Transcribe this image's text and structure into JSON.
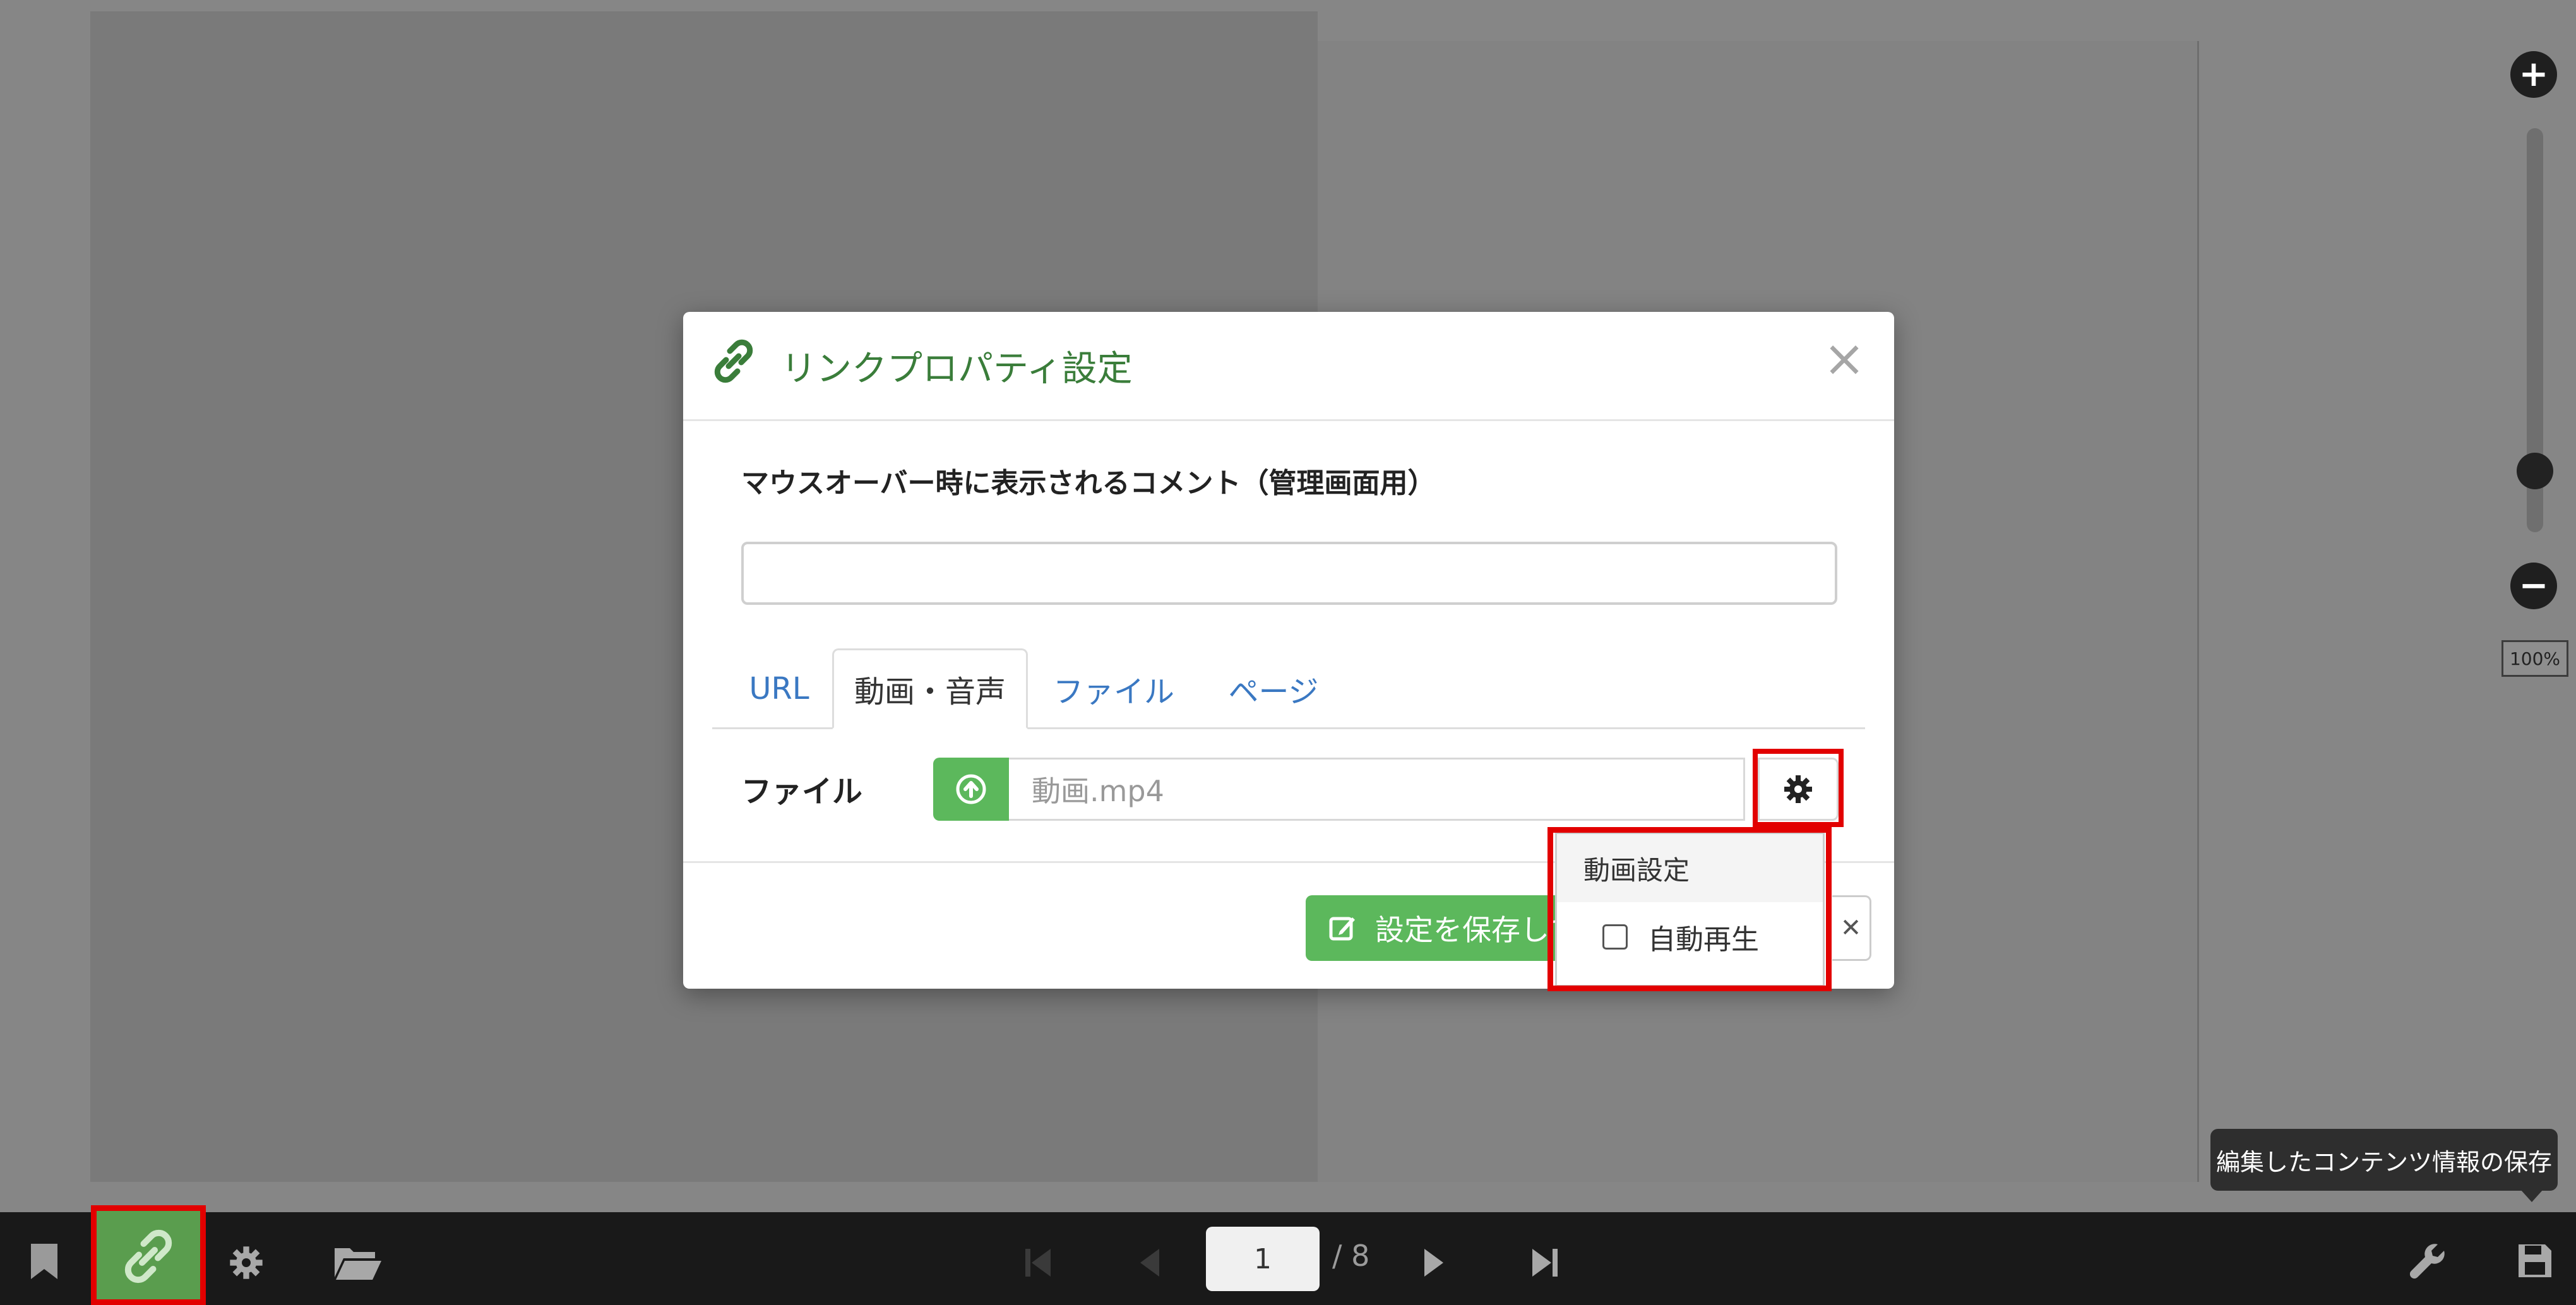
{
  "modal": {
    "title": "リンクプロパティ設定",
    "close_glyph": "×",
    "comment_label": "マウスオーバー時に表示されるコメント（管理画面用）",
    "comment_value": "",
    "tabs": [
      {
        "label": "URL"
      },
      {
        "label": "動画・音声"
      },
      {
        "label": "ファイル"
      },
      {
        "label": "ページ"
      }
    ],
    "active_tab": "動画・音声",
    "file_label": "ファイル",
    "file_value": "動画.mp4",
    "save_label": "設定を保存して",
    "cancel_glyph": "✕"
  },
  "dropdown": {
    "header": "動画設定",
    "autoplay_label": "自動再生",
    "autoplay_checked": false
  },
  "zoom": {
    "level_label": "100%",
    "plus_glyph": "+",
    "minus_glyph": "−"
  },
  "tooltip": {
    "text": "編集したコンテンツ情報の保存"
  },
  "toolbar": {
    "page_current": "1",
    "page_total": "/ 8"
  },
  "colors": {
    "accent_green": "#5cb85c",
    "title_green": "#3a7d3a",
    "highlight_red": "#e20000",
    "toolbar_bg": "#191919"
  }
}
